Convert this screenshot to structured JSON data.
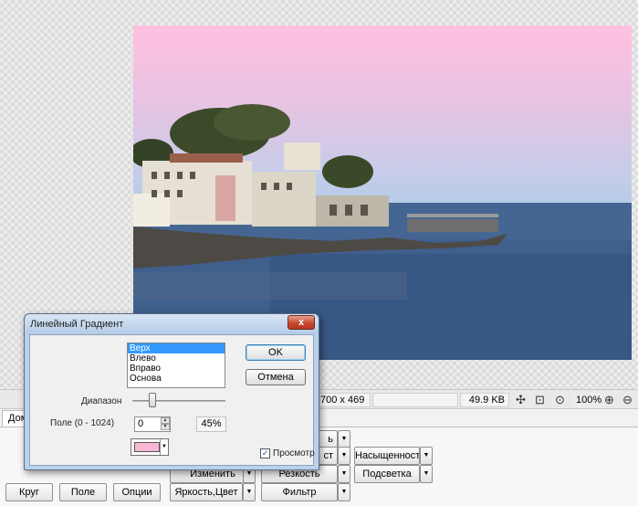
{
  "image": {
    "dimensions_text": "700 x 469",
    "file_size": "49.9 KB",
    "zoom": "100%"
  },
  "statusbar": {
    "icons": [
      "fit-window-icon",
      "actual-size-icon",
      "zoom-fit-icon",
      "zoom-in-icon",
      "zoom-out-icon"
    ]
  },
  "panel": {
    "tab_home": "Дома",
    "row1": {
      "partial_right": "ь"
    },
    "row2": {
      "partial_contrast": "ст",
      "saturation": "Насыщенность"
    },
    "row3": {
      "change": "Изменить",
      "sharpness": "Резкость",
      "highlight": "Подсветка"
    },
    "row4": {
      "circle": "Круг",
      "field": "Поле",
      "options": "Опции",
      "brightness_color": "Яркость,Цвет",
      "filter": "Фильтр"
    }
  },
  "dialog": {
    "title": "Линейный Градиент",
    "close_glyph": "x",
    "direction_list": [
      "Верх",
      "Влево",
      "Вправо",
      "Основа"
    ],
    "selected_index": 0,
    "ok_label": "OK",
    "cancel_label": "Отмена",
    "range_label": "Диапазон",
    "range_value_fraction": 0.22,
    "field_label": "Поле (0 - 1024)",
    "field_value": "0",
    "percent_value": "45%",
    "gradient_color": "#f7b6d2",
    "preview_label": "Просмотр",
    "preview_checked": true
  },
  "colors": {
    "photo_sky_top": "#ffbfe0",
    "sea": "#3e5f8c",
    "dialog_frame": "#b9d1ea",
    "list_selection": "#3399ff"
  }
}
